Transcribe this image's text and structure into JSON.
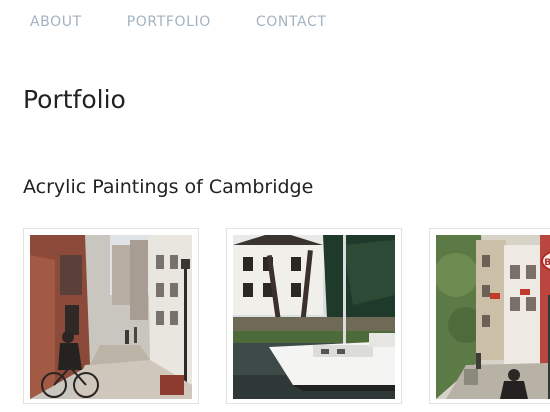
{
  "nav": {
    "items": [
      "ABOUT",
      "PORTFOLIO",
      "CONTACT"
    ]
  },
  "page": {
    "title": "Portfolio"
  },
  "section": {
    "title": "Acrylic Paintings of Cambridge"
  },
  "paintings": [
    {
      "name": "painting-street-cyclist"
    },
    {
      "name": "painting-river-boat"
    },
    {
      "name": "painting-bookshop-street"
    }
  ],
  "colors": {
    "nav": "#a3b3c2",
    "heading": "#222222",
    "frame_border": "#e2e2e2"
  }
}
